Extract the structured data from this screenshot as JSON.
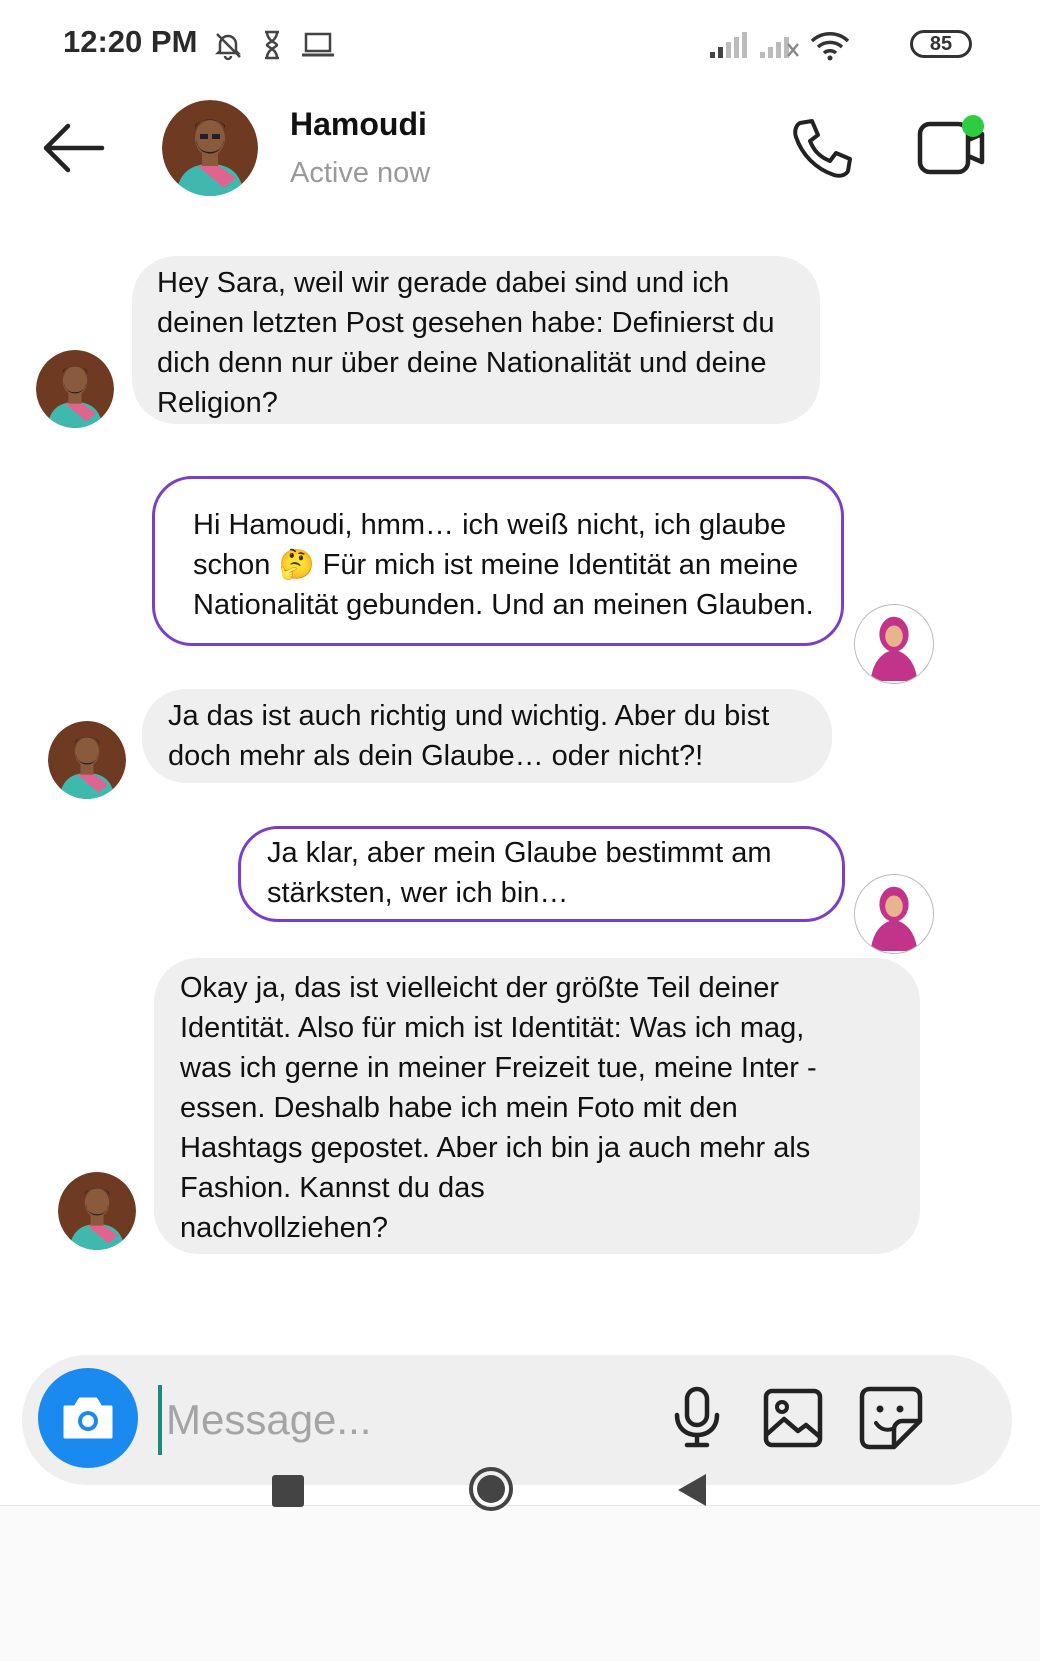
{
  "status_bar": {
    "time": "12:20 PM",
    "battery": "85"
  },
  "header": {
    "contact_name": "Hamoudi",
    "contact_status": "Active now"
  },
  "messages": [
    {
      "sender": "Hamoudi",
      "text": "Hey Sara, weil wir gerade dabei sind und ich\ndeinen letzten Post gesehen habe: Definierst du\ndich denn nur über deine Nationalität und deine\nReligion?"
    },
    {
      "sender": "Sara",
      "text": "Hi Hamoudi, hmm… ich weiß nicht, ich glaube\nschon 🤔 Für mich ist meine Identität an meine\nNationalität gebunden. Und an meinen Glauben."
    },
    {
      "sender": "Hamoudi",
      "text": "Ja das ist auch richtig und wichtig. Aber du bist\ndoch mehr als dein Glaube… oder nicht?!"
    },
    {
      "sender": "Sara",
      "text": "Ja klar, aber mein Glaube bestimmt am\nstärksten, wer ich bin…"
    },
    {
      "sender": "Hamoudi",
      "text": "Okay ja, das ist vielleicht der größte Teil deiner\nIdentität. Also für mich ist Identität: Was ich mag,\nwas ich gerne in meiner Freizeit tue, meine Inter   -\nessen. Deshalb habe ich mein Foto mit den\nHashtags gepostet. Aber ich bin ja auch mehr als\nFashion. Kannst du das\nnachvollziehen?"
    }
  ],
  "composer": {
    "placeholder": "Message..."
  },
  "colors": {
    "accent": "#7a3ec9",
    "camera": "#1a8af0",
    "online": "#2ecc40"
  }
}
